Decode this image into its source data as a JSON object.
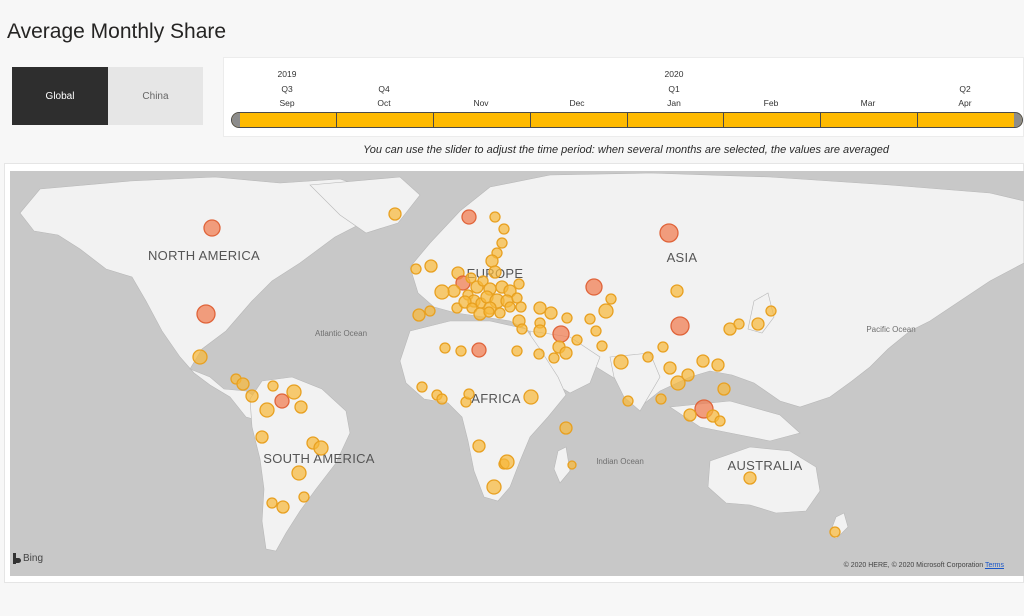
{
  "page": {
    "title": "Average Monthly Share"
  },
  "toggle": {
    "items": [
      {
        "label": "Global",
        "active": true
      },
      {
        "label": "China",
        "active": false
      }
    ]
  },
  "timeline": {
    "headers": [
      {
        "year": "2019",
        "quarter": "Q3",
        "month": "Sep"
      },
      {
        "year": "",
        "quarter": "Q4",
        "month": "Oct"
      },
      {
        "year": "",
        "quarter": "",
        "month": "Nov"
      },
      {
        "year": "",
        "quarter": "",
        "month": "Dec"
      },
      {
        "year": "2020",
        "quarter": "Q1",
        "month": "Jan"
      },
      {
        "year": "",
        "quarter": "",
        "month": "Feb"
      },
      {
        "year": "",
        "quarter": "",
        "month": "Mar"
      },
      {
        "year": "",
        "quarter": "Q2",
        "month": "Apr"
      }
    ],
    "fill_color": "#ffba00",
    "hint": "You can use the slider to adjust the time period: when several months are selected, the values are averaged"
  },
  "map": {
    "regions": [
      "NORTH AMERICA",
      "EUROPE",
      "ASIA",
      "AFRICA",
      "SOUTH AMERICA",
      "AUSTRALIA"
    ],
    "oceans": [
      "Atlantic Ocean",
      "Pacific Ocean",
      "Indian Ocean"
    ],
    "bubble_color_low": "#f6b93b",
    "bubble_color_high": "#f07a4e",
    "provider": "Bing",
    "attribution": "© 2020 HERE, © 2020 Microsoft Corporation",
    "terms_link": "Terms"
  }
}
